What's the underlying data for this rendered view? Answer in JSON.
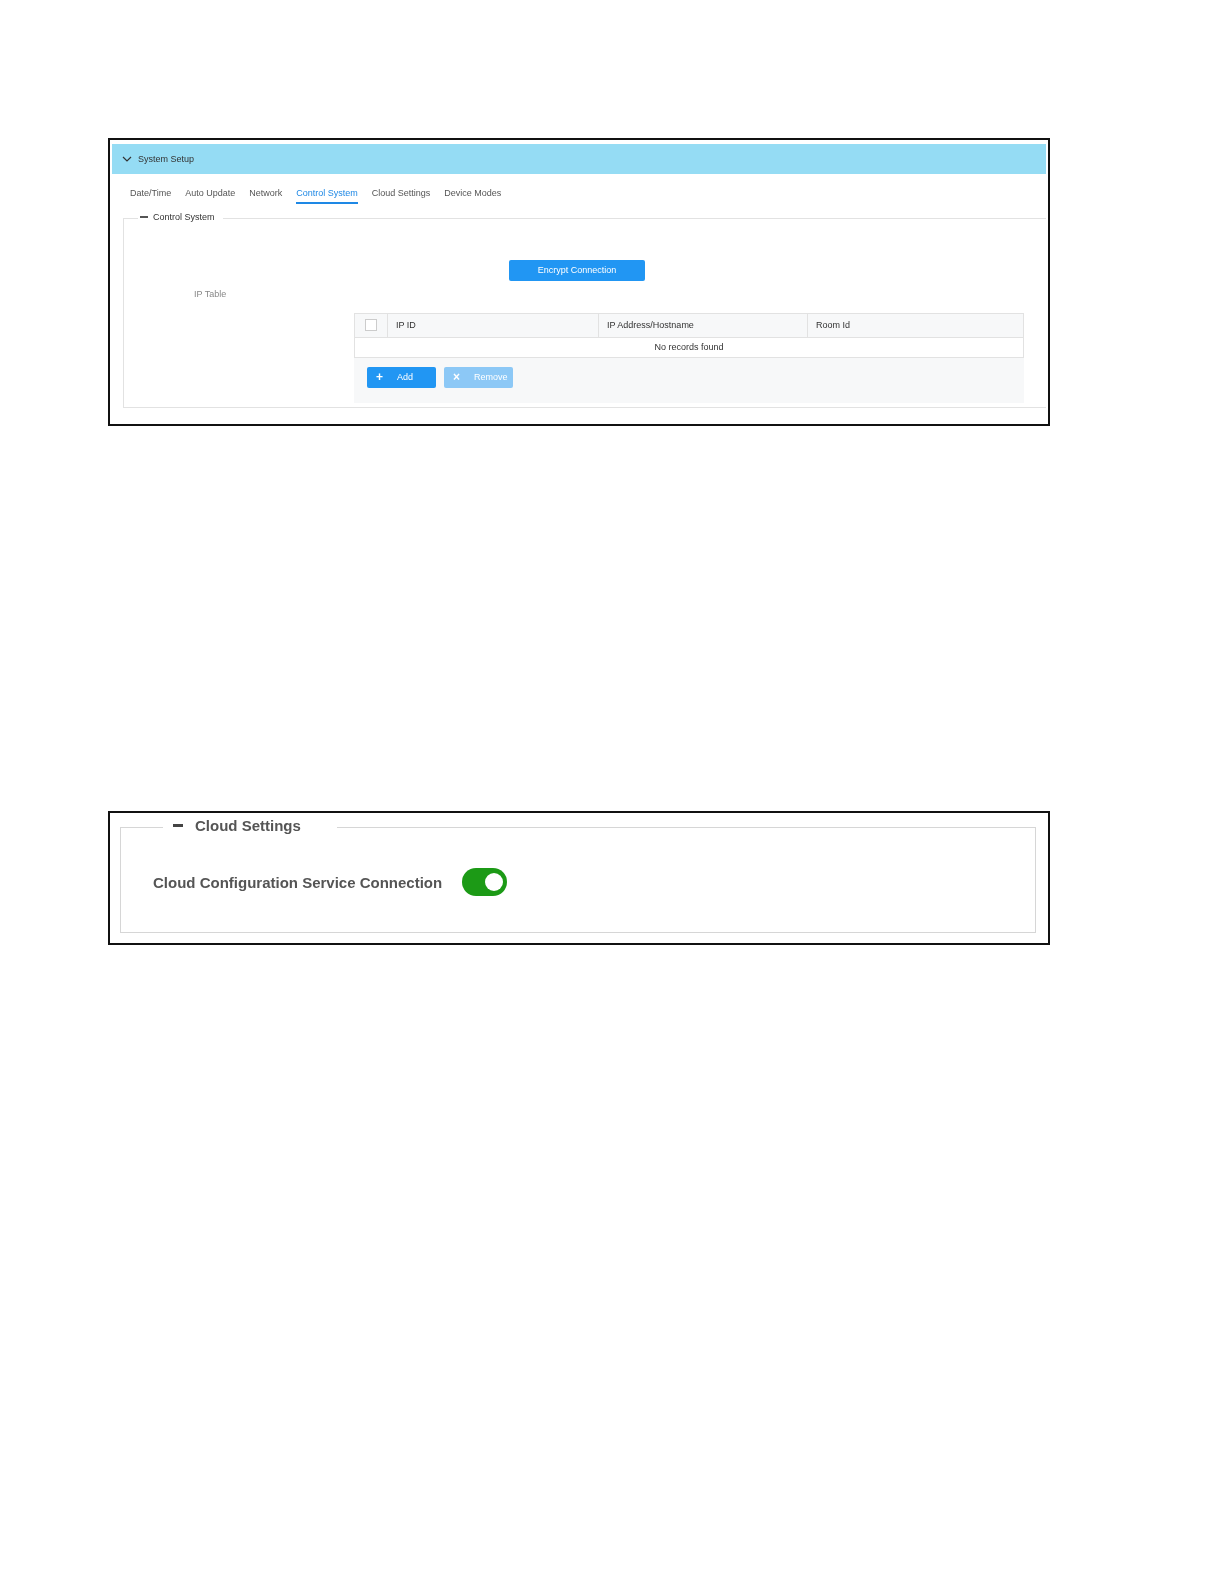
{
  "control_screen": {
    "header": {
      "title": "System Setup",
      "expanded": true
    },
    "tabs": [
      {
        "label": "Date/Time",
        "selected": false
      },
      {
        "label": "Auto Update",
        "selected": false
      },
      {
        "label": "Network",
        "selected": false
      },
      {
        "label": "Control System",
        "selected": true
      },
      {
        "label": "Cloud Settings",
        "selected": false
      },
      {
        "label": "Device Modes",
        "selected": false
      }
    ],
    "section": {
      "title": "Control System",
      "expanded": true
    },
    "encrypt_button": "Encrypt Connection",
    "ip_table_label": "IP Table",
    "table": {
      "select_all": {
        "checked": false
      },
      "columns": [
        "IP ID",
        "IP Address/Hostname",
        "Room Id"
      ],
      "empty_message": "No records found"
    },
    "buttons": [
      {
        "icon": "+",
        "label": "Add",
        "disabled": false
      },
      {
        "icon": "×",
        "label": "Remove",
        "disabled": true
      }
    ]
  },
  "cloud_screen": {
    "section": {
      "title": "Cloud Settings",
      "expanded": true
    },
    "setting": {
      "label": "Cloud Configuration Service Connection",
      "on": true
    }
  }
}
